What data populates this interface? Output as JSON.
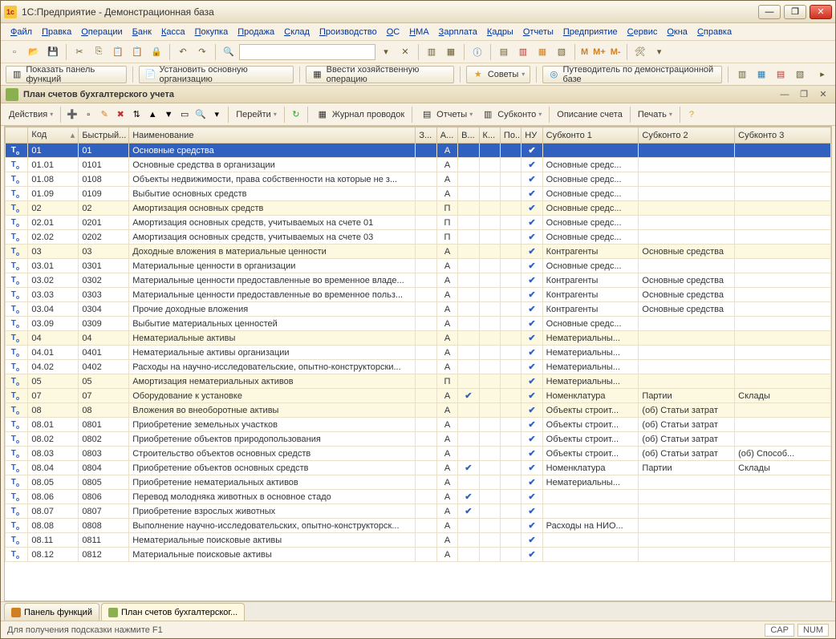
{
  "window": {
    "title": "1С:Предприятие - Демонстрационная база"
  },
  "menu": [
    "Файл",
    "Правка",
    "Операции",
    "Банк",
    "Касса",
    "Покупка",
    "Продажа",
    "Склад",
    "Производство",
    "ОС",
    "НМА",
    "Зарплата",
    "Кадры",
    "Отчеты",
    "Предприятие",
    "Сервис",
    "Окна",
    "Справка"
  ],
  "toolbar2": {
    "show_func": "Показать панель функций",
    "set_org": "Установить основную организацию",
    "oper": "Ввести хозяйственную операцию",
    "tips": "Советы",
    "guide": "Путеводитель по демонстрационной базе"
  },
  "subwindow": {
    "title": "План счетов бухгалтерского учета"
  },
  "sub_toolbar": {
    "actions": "Действия",
    "goto": "Перейти",
    "journal": "Журнал проводок",
    "reports": "Отчеты",
    "subkonto": "Субконто",
    "desc": "Описание счета",
    "print": "Печать"
  },
  "columns": [
    "",
    "Код",
    "Быстрый...",
    "Наименование",
    "З...",
    "А...",
    "В...",
    "К...",
    "По...",
    "НУ",
    "Субконто 1",
    "Субконто 2",
    "Субконто 3"
  ],
  "rows": [
    {
      "y": 1,
      "sel": 1,
      "code": "01",
      "fast": "01",
      "name": "Основные средства",
      "a": "А",
      "nu": 1,
      "s1": ""
    },
    {
      "code": "01.01",
      "fast": "0101",
      "name": "Основные средства в организации",
      "a": "А",
      "nu": 1,
      "s1": "Основные средс..."
    },
    {
      "code": "01.08",
      "fast": "0108",
      "name": "Объекты недвижимости, права собственности на которые не з...",
      "a": "А",
      "nu": 1,
      "s1": "Основные средс..."
    },
    {
      "code": "01.09",
      "fast": "0109",
      "name": "Выбытие основных средств",
      "a": "А",
      "nu": 1,
      "s1": "Основные средс..."
    },
    {
      "y": 1,
      "code": "02",
      "fast": "02",
      "name": "Амортизация основных средств",
      "a": "П",
      "nu": 1,
      "s1": "Основные средс..."
    },
    {
      "code": "02.01",
      "fast": "0201",
      "name": "Амортизация основных средств, учитываемых на счете 01",
      "a": "П",
      "nu": 1,
      "s1": "Основные средс..."
    },
    {
      "code": "02.02",
      "fast": "0202",
      "name": "Амортизация основных средств, учитываемых на счете 03",
      "a": "П",
      "nu": 1,
      "s1": "Основные средс..."
    },
    {
      "y": 1,
      "code": "03",
      "fast": "03",
      "name": "Доходные вложения в материальные ценности",
      "a": "А",
      "nu": 1,
      "s1": "Контрагенты",
      "s2": "Основные средства"
    },
    {
      "code": "03.01",
      "fast": "0301",
      "name": "Материальные ценности в организации",
      "a": "А",
      "nu": 1,
      "s1": "Основные средс..."
    },
    {
      "code": "03.02",
      "fast": "0302",
      "name": "Материальные ценности предоставленные во временное владе...",
      "a": "А",
      "nu": 1,
      "s1": "Контрагенты",
      "s2": "Основные средства"
    },
    {
      "code": "03.03",
      "fast": "0303",
      "name": "Материальные ценности предоставленные во временное польз...",
      "a": "А",
      "nu": 1,
      "s1": "Контрагенты",
      "s2": "Основные средства"
    },
    {
      "code": "03.04",
      "fast": "0304",
      "name": "Прочие доходные вложения",
      "a": "А",
      "nu": 1,
      "s1": "Контрагенты",
      "s2": "Основные средства"
    },
    {
      "code": "03.09",
      "fast": "0309",
      "name": "Выбытие материальных ценностей",
      "a": "А",
      "nu": 1,
      "s1": "Основные средс..."
    },
    {
      "y": 1,
      "code": "04",
      "fast": "04",
      "name": "Нематериальные активы",
      "a": "А",
      "nu": 1,
      "s1": "Нематериальны..."
    },
    {
      "code": "04.01",
      "fast": "0401",
      "name": "Нематериальные активы организации",
      "a": "А",
      "nu": 1,
      "s1": "Нематериальны..."
    },
    {
      "code": "04.02",
      "fast": "0402",
      "name": "Расходы на научно-исследовательские, опытно-конструкторски...",
      "a": "А",
      "nu": 1,
      "s1": "Нематериальны..."
    },
    {
      "y": 1,
      "code": "05",
      "fast": "05",
      "name": "Амортизация нематериальных активов",
      "a": "П",
      "nu": 1,
      "s1": "Нематериальны..."
    },
    {
      "y": 1,
      "code": "07",
      "fast": "07",
      "name": "Оборудование к установке",
      "a": "А",
      "v": 1,
      "nu": 1,
      "s1": "Номенклатура",
      "s2": "Партии",
      "s3": "Склады"
    },
    {
      "y": 1,
      "code": "08",
      "fast": "08",
      "name": "Вложения во внеоборотные активы",
      "a": "А",
      "nu": 1,
      "s1": "Объекты строит...",
      "s2": "(об) Статьи затрат"
    },
    {
      "code": "08.01",
      "fast": "0801",
      "name": "Приобретение земельных участков",
      "a": "А",
      "nu": 1,
      "s1": "Объекты строит...",
      "s2": "(об) Статьи затрат"
    },
    {
      "code": "08.02",
      "fast": "0802",
      "name": "Приобретение объектов природопользования",
      "a": "А",
      "nu": 1,
      "s1": "Объекты строит...",
      "s2": "(об) Статьи затрат"
    },
    {
      "code": "08.03",
      "fast": "0803",
      "name": "Строительство объектов основных средств",
      "a": "А",
      "nu": 1,
      "s1": "Объекты строит...",
      "s2": "(об) Статьи затрат",
      "s3": "(об) Способ..."
    },
    {
      "code": "08.04",
      "fast": "0804",
      "name": "Приобретение объектов основных средств",
      "a": "А",
      "v": 1,
      "nu": 1,
      "s1": "Номенклатура",
      "s2": "Партии",
      "s3": "Склады"
    },
    {
      "code": "08.05",
      "fast": "0805",
      "name": "Приобретение нематериальных активов",
      "a": "А",
      "nu": 1,
      "s1": "Нематериальны..."
    },
    {
      "code": "08.06",
      "fast": "0806",
      "name": "Перевод молодняка животных в основное стадо",
      "a": "А",
      "v": 1,
      "nu": 1
    },
    {
      "code": "08.07",
      "fast": "0807",
      "name": "Приобретение взрослых животных",
      "a": "А",
      "v": 1,
      "nu": 1
    },
    {
      "code": "08.08",
      "fast": "0808",
      "name": "Выполнение научно-исследовательских, опытно-конструкторск...",
      "a": "А",
      "nu": 1,
      "s1": "Расходы на НИО..."
    },
    {
      "code": "08.11",
      "fast": "0811",
      "name": "Нематериальные поисковые активы",
      "a": "А",
      "nu": 1
    },
    {
      "code": "08.12",
      "fast": "0812",
      "name": "Материальные поисковые активы",
      "a": "А",
      "nu": 1
    }
  ],
  "tabs": {
    "panel": "Панель функций",
    "plan": "План счетов бухгалтерског..."
  },
  "status": {
    "hint": "Для получения подсказки нажмите F1",
    "cap": "CAP",
    "num": "NUM"
  }
}
